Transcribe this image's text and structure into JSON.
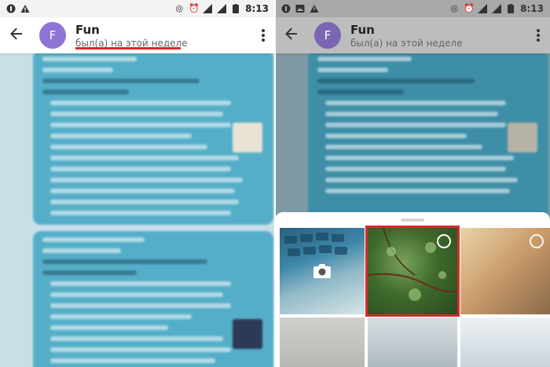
{
  "status_bar": {
    "time": "8:13"
  },
  "chat": {
    "name": "Fun",
    "avatar_letter": "F",
    "last_seen": "был(а) на этой неделе"
  },
  "colors": {
    "avatar": "#8f74d6",
    "bubble": "#55aec8",
    "chat_bg": "#c8dfe8",
    "highlight": "#d62b2b"
  },
  "icons": [
    "back-arrow-icon",
    "more-vert-icon",
    "camera-icon",
    "select-circle-icon"
  ]
}
